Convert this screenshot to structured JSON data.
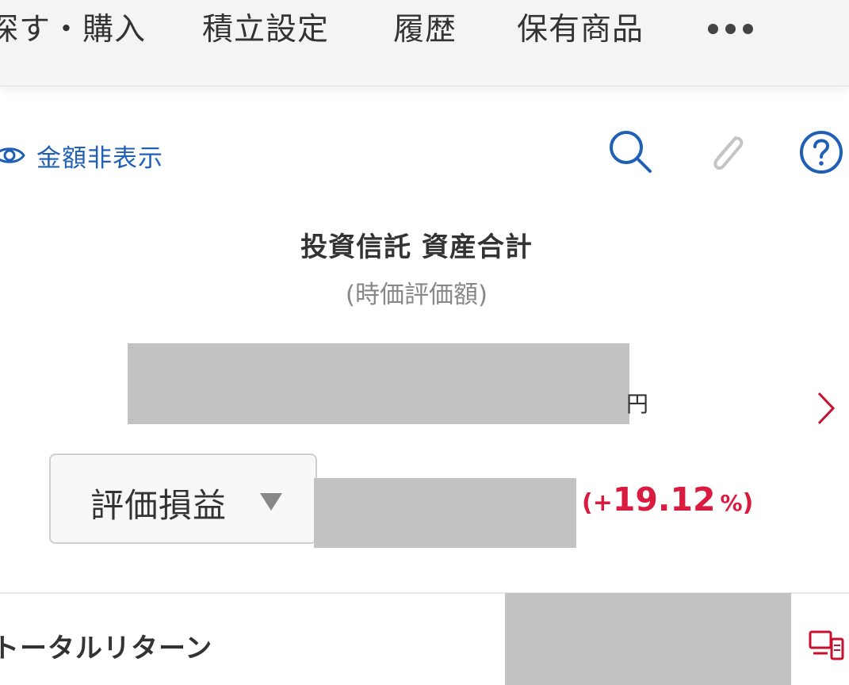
{
  "nav": {
    "tabs": [
      {
        "label": "探す・購入"
      },
      {
        "label": "積立設定"
      },
      {
        "label": "履歴"
      },
      {
        "label": "保有商品"
      }
    ],
    "more_icon": "more-dots-icon"
  },
  "toolbar": {
    "hide_amount_label": "金額非表示",
    "icons": [
      "eye-icon",
      "search-icon",
      "paperclip-icon",
      "help-icon"
    ]
  },
  "summary": {
    "title": "投資信託 資産合計",
    "subtitle": "(時価評価額)",
    "currency": "円",
    "amount_masked": true
  },
  "evaluation": {
    "select_label": "評価損益",
    "percent_open": "(+",
    "percent_value": "19.12",
    "percent_unit": "%",
    "percent_close": ")",
    "percent_color": "#d81b3f",
    "amount_masked": true
  },
  "total_return": {
    "label": "トータルリターン",
    "amount_masked": true,
    "icon": "device-icon"
  },
  "colors": {
    "accent_blue": "#1f5fb5",
    "positive_red": "#d81b3f",
    "icon_red": "#c8102e",
    "mask_gray": "#c2c2c2"
  }
}
